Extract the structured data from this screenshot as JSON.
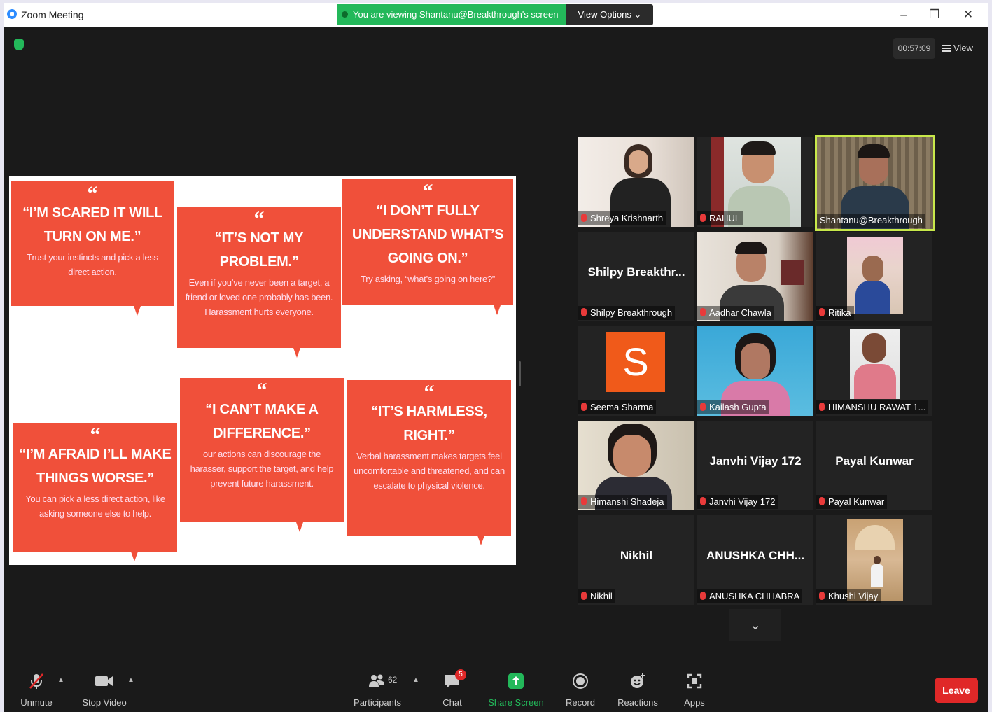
{
  "window": {
    "title": "Zoom Meeting",
    "banner": "You are viewing Shantanu@Breakthrough's screen",
    "view_options": "View Options",
    "timer": "00:57:09",
    "view": "View"
  },
  "slide": {
    "bubbles": [
      {
        "mark": "“",
        "quote": "“I’M SCARED IT WILL TURN ON ME.”",
        "sub": "Trust your instincts and pick a less direct action."
      },
      {
        "mark": "“",
        "quote": "“IT’S NOT MY PROBLEM.”",
        "sub": "Even if you’ve never been a target, a friend or loved one probably has been. Harassment hurts everyone."
      },
      {
        "mark": "“",
        "quote": "“I DON’T FULLY UNDERSTAND WHAT’S GOING ON.”",
        "sub": "Try asking, “what’s going on here?”"
      },
      {
        "mark": "“",
        "quote": "“I’M AFRAID I’LL MAKE THINGS WORSE.”",
        "sub": "You can pick a less direct action, like asking someone else to help."
      },
      {
        "mark": "“",
        "quote": "“I CAN’T MAKE A DIFFERENCE.”",
        "sub": "our actions can discourage the harasser, support the target, and help prevent future harassment."
      },
      {
        "mark": "“",
        "quote": "“IT’S HARMLESS, RIGHT.”",
        "sub": "Verbal harassment makes targets feel uncomfortable and threatened, and can escalate to physical violence."
      }
    ]
  },
  "participants": [
    {
      "name": "Shreya Krishnarth",
      "display": ""
    },
    {
      "name": "RAHUL",
      "display": ""
    },
    {
      "name": "Shantanu@Breakthrough",
      "display": ""
    },
    {
      "name": "Shilpy Breakthrough",
      "display": "Shilpy  Breakthr..."
    },
    {
      "name": "Aadhar Chawla",
      "display": ""
    },
    {
      "name": "Ritika",
      "display": ""
    },
    {
      "name": "Seema Sharma",
      "display": "S"
    },
    {
      "name": "Kailash Gupta",
      "display": ""
    },
    {
      "name": "HIMANSHU RAWAT 1...",
      "display": ""
    },
    {
      "name": "Himanshi Shadeja",
      "display": ""
    },
    {
      "name": "Janvhi Vijay 172",
      "display": "Janvhi Vijay 172"
    },
    {
      "name": "Payal Kunwar",
      "display": "Payal Kunwar"
    },
    {
      "name": "Nikhil",
      "display": "Nikhil"
    },
    {
      "name": "ANUSHKA CHHABRA",
      "display": "ANUSHKA  CHH..."
    },
    {
      "name": "Khushi Vijay",
      "display": ""
    }
  ],
  "toolbar": {
    "unmute": "Unmute",
    "stop_video": "Stop Video",
    "participants": "Participants",
    "participants_count": "62",
    "chat": "Chat",
    "chat_badge": "5",
    "share_screen": "Share Screen",
    "record": "Record",
    "reactions": "Reactions",
    "apps": "Apps",
    "leave": "Leave"
  },
  "colors": {
    "bubble": "#f0503a",
    "share_green": "#23b85a",
    "active_speaker": "#c8e84a",
    "leave_red": "#e02828"
  }
}
